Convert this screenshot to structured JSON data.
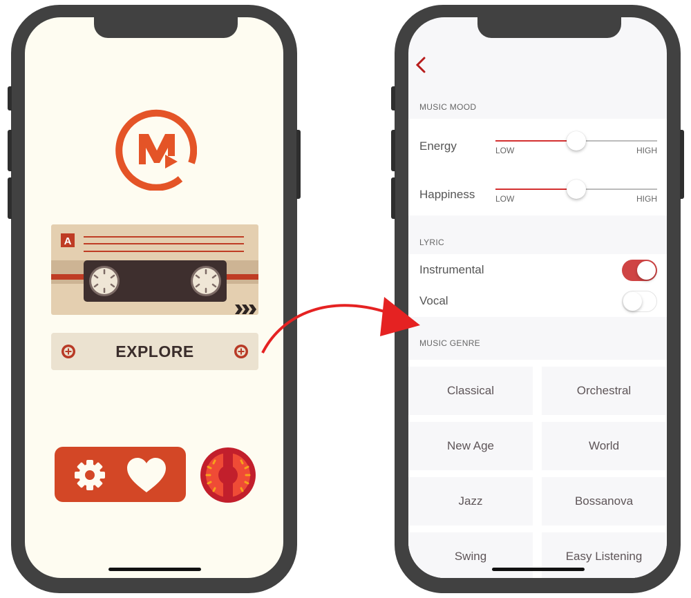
{
  "left_screen": {
    "logo": {
      "icon": "music-logo-icon",
      "letter": "M"
    },
    "cassette": {
      "side_label": "A",
      "icon": "cassette-tape-icon",
      "arrows": "›››"
    },
    "explore_button": {
      "label": "EXPLORE"
    },
    "actions": {
      "settings_icon": "gear-icon",
      "favorites_icon": "heart-icon",
      "timer_icon": "tomato-timer-icon"
    }
  },
  "right_screen": {
    "back_icon": "chevron-left-icon",
    "music_mood": {
      "header": "MUSIC MOOD",
      "sliders": [
        {
          "label": "Energy",
          "low": "LOW",
          "high": "HIGH",
          "value": 0.5
        },
        {
          "label": "Happiness",
          "low": "LOW",
          "high": "HIGH",
          "value": 0.5
        }
      ]
    },
    "lyric": {
      "header": "LYRIC",
      "toggles": [
        {
          "label": "Instrumental",
          "on": true
        },
        {
          "label": "Vocal",
          "on": false
        }
      ]
    },
    "music_genre": {
      "header": "MUSIC GENRE",
      "items": [
        "Classical",
        "Orchestral",
        "New Age",
        "World",
        "Jazz",
        "Bossanova",
        "Swing",
        "Easy Listening"
      ]
    }
  },
  "colors": {
    "accent_red": "#d32f2f",
    "brand_orange": "#e45427",
    "toggle_on": "#cf4444",
    "cream_bg": "#fefcf1",
    "phone_frame": "#414141",
    "arrow_red": "#e52222"
  }
}
